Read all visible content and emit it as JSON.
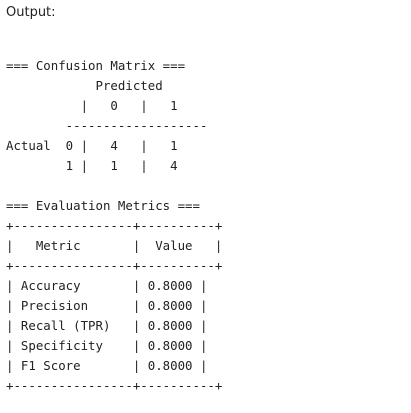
{
  "output_label": "Output:",
  "console": {
    "lines": [
      "=== Confusion Matrix ===",
      "            Predicted",
      "          |   0   |   1",
      "        -------------------",
      "Actual  0 |   4   |   1",
      "        1 |   1   |   4",
      "",
      "=== Evaluation Metrics ===",
      "+----------------+----------+",
      "|   Metric       |  Value   |",
      "+----------------+----------+",
      "| Accuracy       | 0.8000 |",
      "| Precision      | 0.8000 |",
      "| Recall (TPR)   | 0.8000 |",
      "| Specificity    | 0.8000 |",
      "| F1 Score       | 0.8000 |",
      "+----------------+----------+"
    ]
  }
}
